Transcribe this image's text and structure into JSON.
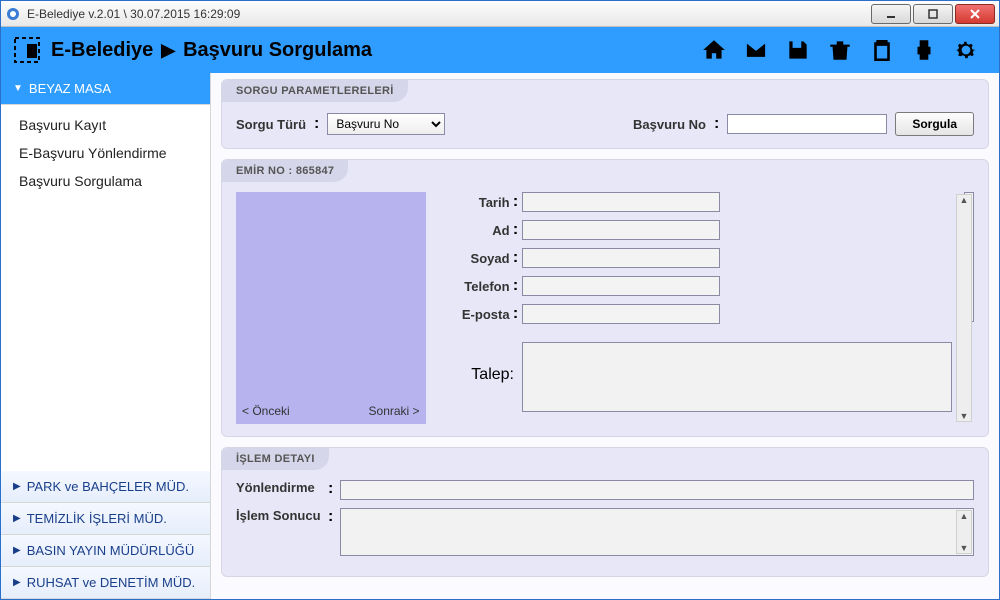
{
  "window": {
    "title": "E-Belediye v.2.01 \\ 30.07.2015 16:29:09"
  },
  "header": {
    "app_name": "E-Belediye",
    "page_title": "Başvuru Sorgulama"
  },
  "sidebar": {
    "sections": [
      {
        "label": "BEYAZ MASA",
        "expanded": true
      },
      {
        "label": "PARK ve BAHÇELER MÜD.",
        "expanded": false
      },
      {
        "label": "TEMİZLİK İŞLERİ MÜD.",
        "expanded": false
      },
      {
        "label": "BASIN YAYIN MÜDÜRLÜĞÜ",
        "expanded": false
      },
      {
        "label": "RUHSAT ve DENETİM MÜD.",
        "expanded": false
      }
    ],
    "beyaz_masa_items": [
      {
        "label": "Başvuru Kayıt"
      },
      {
        "label": "E-Başvuru Yönlendirme"
      },
      {
        "label": "Başvuru Sorgulama"
      }
    ]
  },
  "query_panel": {
    "title": "SORGU PARAMETLERELERİ",
    "type_label": "Sorgu Türü",
    "type_value": "Başvuru No",
    "number_label": "Başvuru No",
    "number_value": "",
    "button": "Sorgula"
  },
  "emir_panel": {
    "title": "EMİR NO : 865847",
    "prev": "< Önceki",
    "next": "Sonraki >",
    "fields": {
      "tarih_label": "Tarih",
      "tarih": "",
      "ad_label": "Ad",
      "ad": "",
      "soyad_label": "Soyad",
      "soyad": "",
      "telefon_label": "Telefon",
      "telefon": "",
      "eposta_label": "E-posta",
      "eposta": "",
      "talep_label": "Talep",
      "talep": "",
      "note": ""
    }
  },
  "detail_panel": {
    "title": "İŞLEM DETAYI",
    "yonlendirme_label": "Yönlendirme",
    "yonlendirme": "",
    "sonuc_label": "İşlem Sonucu",
    "sonuc": ""
  }
}
